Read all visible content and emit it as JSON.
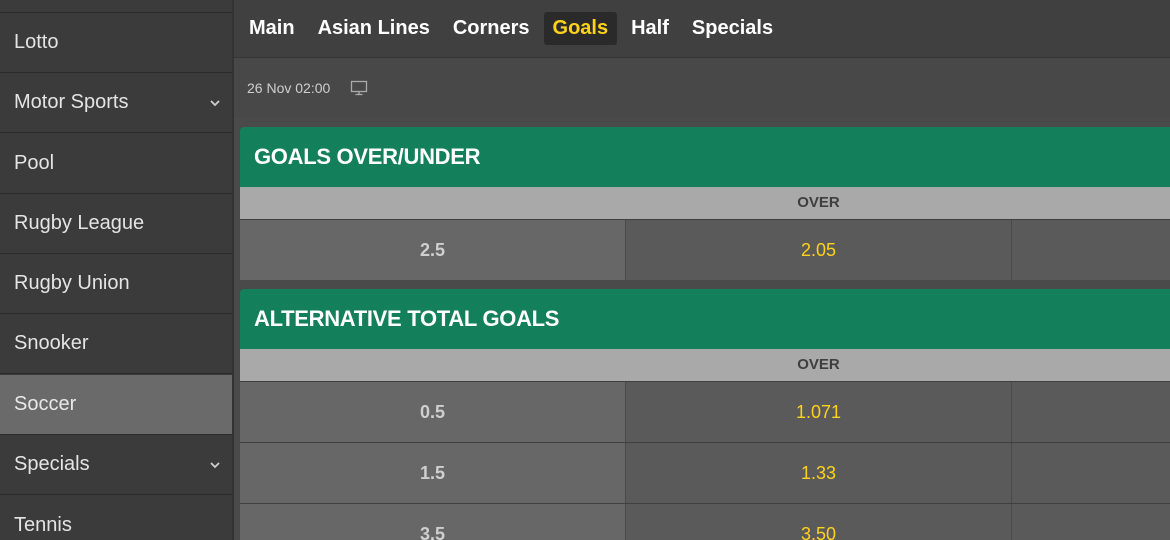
{
  "sidebar": {
    "items": [
      {
        "label": "Lotto",
        "chevron": false
      },
      {
        "label": "Motor Sports",
        "chevron": true
      },
      {
        "label": "Pool",
        "chevron": false
      },
      {
        "label": "Rugby League",
        "chevron": false
      },
      {
        "label": "Rugby Union",
        "chevron": false
      },
      {
        "label": "Snooker",
        "chevron": false
      },
      {
        "label": "Soccer",
        "chevron": false,
        "active": true
      },
      {
        "label": "Specials",
        "chevron": true
      },
      {
        "label": "Tennis",
        "chevron": false
      }
    ]
  },
  "tabs": [
    {
      "label": "Main"
    },
    {
      "label": "Asian Lines"
    },
    {
      "label": "Corners"
    },
    {
      "label": "Goals",
      "active": true
    },
    {
      "label": "Half"
    },
    {
      "label": "Specials"
    }
  ],
  "event": {
    "datetime": "26 Nov 02:00",
    "icon": "tv-icon"
  },
  "markets": [
    {
      "title": "GOALS OVER/UNDER",
      "column": "OVER",
      "rows": [
        {
          "line": "2.5",
          "over": "2.05"
        }
      ]
    },
    {
      "title": "ALTERNATIVE TOTAL GOALS",
      "column": "OVER",
      "rows": [
        {
          "line": "0.5",
          "over": "1.071"
        },
        {
          "line": "1.5",
          "over": "1.33"
        },
        {
          "line": "3.5",
          "over": "3.50"
        }
      ]
    }
  ],
  "colors": {
    "accent": "#ffd21a",
    "market_header": "#137f5b"
  }
}
